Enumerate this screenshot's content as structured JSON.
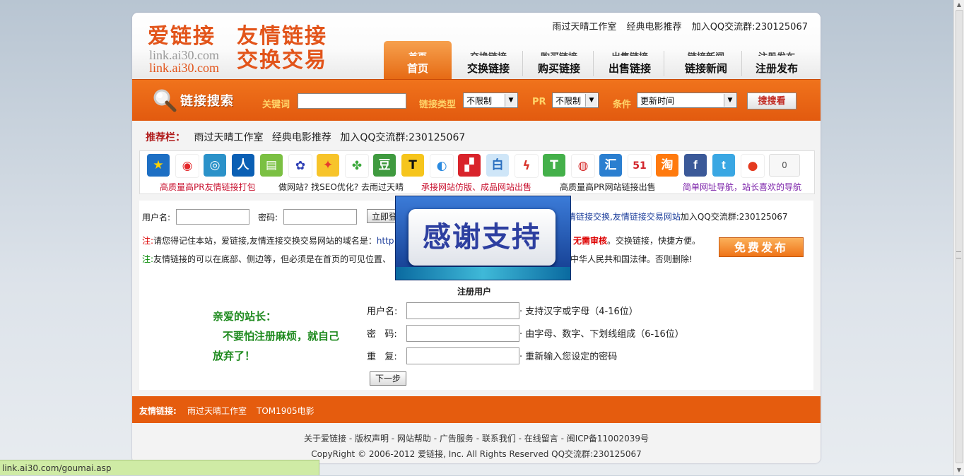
{
  "header": {
    "logo_cn_1": "爱链接",
    "logo_cn_2": "友情链接",
    "logo_en_1": "link.ai30.com",
    "logo_en_2": "link.ai30.com",
    "logo_swap": "交换交易",
    "top_links": [
      "雨过天晴工作室",
      "经典电影推荐",
      "加入QQ交流群:230125067"
    ]
  },
  "nav": [
    {
      "label": "首页",
      "ghost": "首页",
      "active": true
    },
    {
      "label": "交换链接",
      "ghost": "交换链接"
    },
    {
      "label": "购买链接",
      "ghost": "购买链接"
    },
    {
      "label": "出售链接",
      "ghost": "出售链接"
    },
    {
      "label": "链接新闻",
      "ghost": "链接新闻"
    },
    {
      "label": "注册发布",
      "ghost": "注册发布"
    }
  ],
  "search": {
    "title": "链接搜索",
    "keyword_label": "关键词",
    "keyword_value": "",
    "type_label": "链接类型",
    "type_value": "不限制",
    "pr_label": "PR",
    "pr_value": "不限制",
    "cond_label": "条件",
    "cond_value": "更新时间",
    "button": "搜搜看"
  },
  "recommend": {
    "heading": "推荐栏：",
    "links": [
      "雨过天晴工作室",
      "经典电影推荐",
      "加入QQ交流群:230125067"
    ]
  },
  "icon_strip": {
    "icons": [
      "qzone-icon",
      "weibo-icon",
      "tencent-weibo-icon",
      "renren-icon",
      "kaixin-icon",
      "baidu-icon",
      "qq-space-icon",
      "clover-icon",
      "douban-icon",
      "t-icon",
      "360-icon",
      "digg-icon",
      "baidu-bai-icon",
      "seagull-icon",
      "t-green-icon",
      "netease-icon",
      "hui-icon",
      "51-icon",
      "taobao-icon",
      "facebook-icon",
      "twitter-icon",
      "apple-icon"
    ],
    "counter": "0",
    "links": [
      "高质量高PR友情链接打包",
      "做网站? 找SEO优化? 去雨过天晴",
      "承接网站仿版、成品网站出售",
      "高质量高PR网站链接出售",
      "简单网址导航，站长喜欢的导航"
    ]
  },
  "login": {
    "user_label": "用户名:",
    "pass_label": "密码:",
    "button": "立即登",
    "tail_a": "情链接交换",
    "tail_b": ",友情链接交易网站",
    "tail_c": "加入QQ交流群:230125067"
  },
  "notes": {
    "n1_prefix": "注:",
    "n1_text": "请您得记住本站，爱链接,友情连接交换交易网站的域名是：",
    "n1_url": "http",
    "n1_red": "无需审核",
    "n1_tail": "。交换链接，快捷方便。",
    "n2_prefix": "注:",
    "n2_text": "友情链接的可以在底部、侧边等，但必须是在首页的可见位置、",
    "n2_tail": "中华人民共和国法律。否则删除!",
    "free_button": "免费发布"
  },
  "register": {
    "title": "注册用户",
    "dear_1": "亲爱的站长：",
    "dear_2": "不要怕注册麻烦，就自己",
    "dear_3": "放弃了！",
    "rows": [
      {
        "label": "用户名:",
        "hint": "· 支持汉字或字母（4-16位）"
      },
      {
        "label": "密   码:",
        "hint": "· 由字母、数字、下划线组成（6-16位）"
      },
      {
        "label": "重   复:",
        "hint": "· 重新输入您设定的密码"
      }
    ],
    "next": "下一步"
  },
  "friend_links": {
    "heading": "友情链接:",
    "links": [
      "雨过天晴工作室",
      "TOM1905电影"
    ]
  },
  "footer": {
    "line1": "关于爱链接 - 版权声明 - 网站帮助 - 广告服务 - 联系我们 - 在线留言 - 闽ICP备11002039号",
    "line2": "CopyRight © 2006-2012 爱链接, Inc. All Rights Reserved QQ交流群:230125067"
  },
  "popup": {
    "text": "感谢支持"
  },
  "status_bar": "link.ai30.com/goumai.asp",
  "colors": {
    "accent": "#e55c0e",
    "nav_active": "#ef7a20",
    "green_text": "#1e8a1e"
  }
}
